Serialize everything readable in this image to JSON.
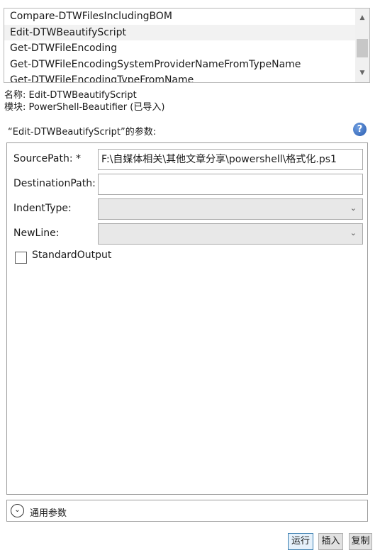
{
  "command_list": {
    "items": [
      "Compare-DTWFilesIncludingBOM",
      "Edit-DTWBeautifyScript",
      "Get-DTWFileEncoding",
      "Get-DTWFileEncodingSystemProviderNameFromTypeName",
      "Get-DTWFileEncodingTypeFromName"
    ],
    "selected_index": 1
  },
  "info": {
    "name_line": "名称: Edit-DTWBeautifyScript",
    "module_line": "模块: PowerShell-Beautifier (已导入)"
  },
  "params": {
    "title": "“Edit-DTWBeautifyScript”的参数:",
    "help_glyph": "?",
    "fields": {
      "source_path_label": "SourcePath: *",
      "source_path_value": "F:\\自媒体相关\\其他文章分享\\powershell\\格式化.ps1",
      "destination_path_label": "DestinationPath:",
      "destination_path_value": "",
      "indent_type_label": "IndentType:",
      "indent_type_value": "",
      "new_line_label": "NewLine:",
      "new_line_value": "",
      "standard_output_label": "StandardOutput"
    }
  },
  "common_params": {
    "label": "通用参数"
  },
  "buttons": {
    "run": "运行",
    "insert": "插入",
    "copy": "复制"
  },
  "icons": {
    "scroll_up": "scroll-up-arrow-icon",
    "scroll_down": "scroll-down-arrow-icon",
    "help": "help-icon",
    "chevron": "chevron-down-icon",
    "expand": "expand-circle-icon"
  },
  "colors": {
    "selected_row": "#f2f2f2",
    "combo_bg": "#e8e8e8",
    "help_blue": "#2a5db0",
    "primary_border": "#3c7fb1"
  }
}
